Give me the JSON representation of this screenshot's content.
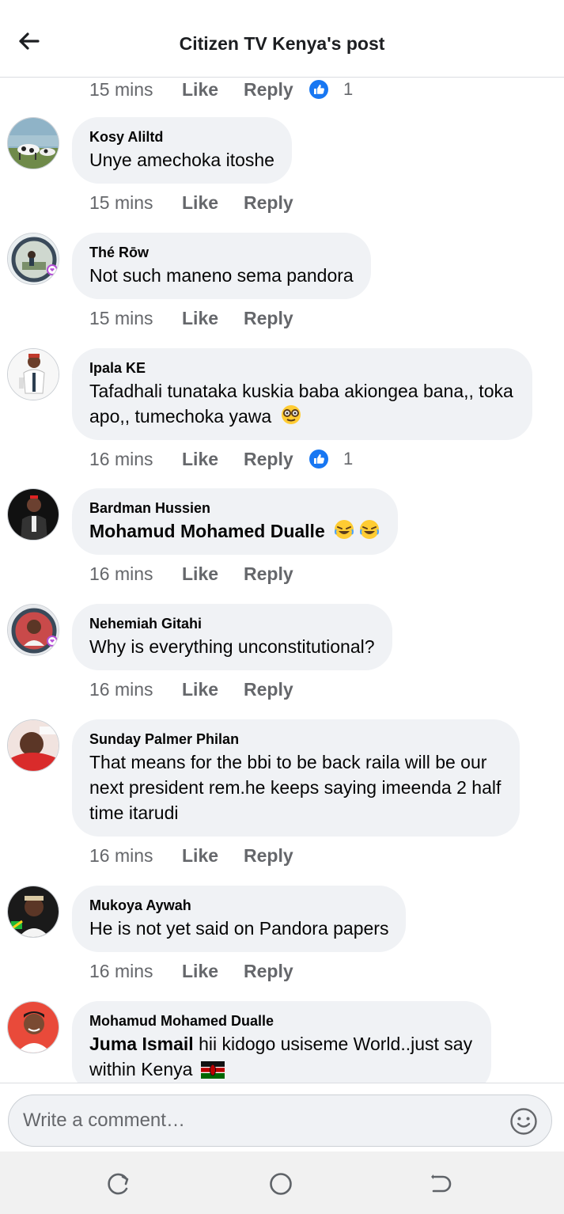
{
  "header": {
    "title": "Citizen TV Kenya's post"
  },
  "top_meta": {
    "time": "15 mins",
    "like": "Like",
    "reply": "Reply",
    "reaction_count": "1"
  },
  "comments": [
    {
      "name": "Kosy Aliltd",
      "text": "Unye amechoka itoshe",
      "time": "15 mins",
      "like": "Like",
      "reply": "Reply",
      "reaction_count": ""
    },
    {
      "name": "Thé Rōw",
      "text": "Not such maneno sema pandora",
      "time": "15 mins",
      "like": "Like",
      "reply": "Reply",
      "reaction_count": ""
    },
    {
      "name": "Ipala KE",
      "text_line1": "Tafadhali tunataka kuskia baba akiongea bana,, toka",
      "text_line2": "apo,, tumechoka yawa",
      "time": "16 mins",
      "like": "Like",
      "reply": "Reply",
      "reaction_count": "1"
    },
    {
      "name": "Bardman Hussien",
      "mention": "Mohamud Mohamed Dualle",
      "time": "16 mins",
      "like": "Like",
      "reply": "Reply",
      "reaction_count": ""
    },
    {
      "name": "Nehemiah Gitahi",
      "text": "Why is everything unconstitutional?",
      "time": "16 mins",
      "like": "Like",
      "reply": "Reply",
      "reaction_count": ""
    },
    {
      "name": "Sunday Palmer Philan",
      "text_line1": "That means for the bbi to be back raila will be our",
      "text_line2": "next president rem.he keeps saying imeenda 2 half",
      "text_line3": "time itarudi",
      "time": "16 mins",
      "like": "Like",
      "reply": "Reply",
      "reaction_count": ""
    },
    {
      "name": "Mukoya Aywah",
      "text": "He is not yet said on Pandora papers",
      "time": "16 mins",
      "like": "Like",
      "reply": "Reply",
      "reaction_count": ""
    },
    {
      "name": "Mohamud Mohamed Dualle",
      "mention": "Juma Ismail",
      "text_line1": " hii kidogo usiseme World..just say",
      "text_line2": "within Kenya"
    }
  ],
  "composer": {
    "placeholder": "Write a comment…"
  },
  "colors": {
    "like_blue": "#1877f2",
    "bubble": "#f0f2f5",
    "meta_gray": "#65676b"
  },
  "icons": {
    "back": "arrow-left-icon",
    "like_reaction": "thumbs-up-icon",
    "emoji_picker": "smiley-icon",
    "nav_recent": "recent-apps-icon",
    "nav_home": "home-circle-icon",
    "nav_back": "nav-back-icon"
  }
}
